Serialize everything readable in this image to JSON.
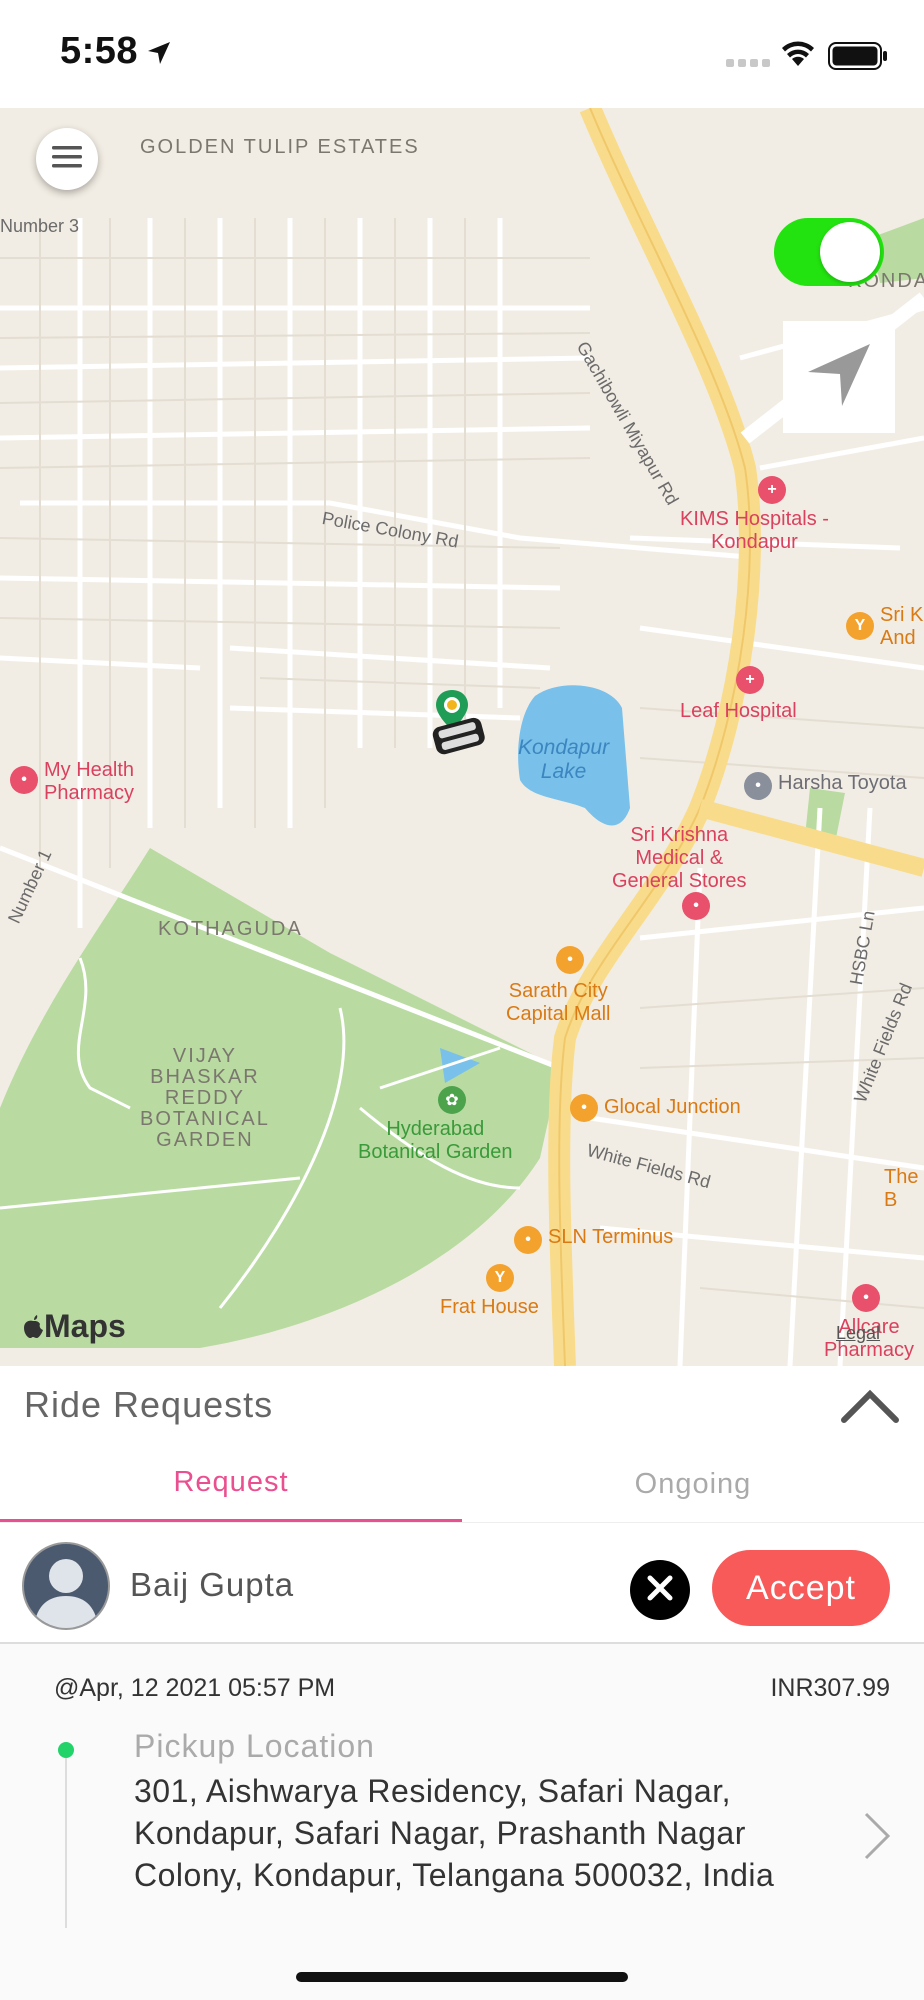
{
  "status_bar": {
    "time": "5:58",
    "icons": [
      "location-arrow-icon",
      "signal-icon",
      "wifi-icon",
      "battery-icon"
    ]
  },
  "map": {
    "areas": [
      "GOLDEN TULIP\nESTATES",
      "KOTHAGUDA",
      "VIJAY\nBHASKAR\nREDDY\nBOTANICAL\nGARDEN"
    ],
    "water": [
      "Kondapur\nLake"
    ],
    "roads": [
      "Gachibowli Miyapur Rd",
      "Police Colony Rd",
      "White Fields Rd",
      "HSBC Ln",
      "White Fields Rd",
      "Number 3",
      "Number 1"
    ],
    "pois": {
      "kims": "KIMS Hospitals -\nKondapur",
      "leaf": "Leaf Hospital",
      "myhealth": "My Health\nPharmacy",
      "harsha": "Harsha Toyota",
      "srikrishna": "Sri Krishna\nMedical &\nGeneral Stores",
      "sarath": "Sarath City\nCapital Mall",
      "hyd_botanical": "Hyderabad\nBotanical Garden",
      "glocal": "Glocal Junction",
      "sln": "SLN Terminus",
      "frat": "Frat House",
      "allcare": "Allcare\nPharmacy",
      "sri_k_partial": "Sri K\nAnd",
      "the_b_partial": "The\nB",
      "kondapur_partial": "KONDAPU"
    },
    "brand": "Maps",
    "legal": "Legal",
    "online_toggle": "on",
    "colors": {
      "toggle": "#22e30f",
      "park": "#b9dba1",
      "water": "#79c0ea",
      "major_road": "#f8dc8c"
    }
  },
  "sheet": {
    "title": "Ride Requests",
    "tabs": [
      {
        "label": "Request",
        "active": true
      },
      {
        "label": "Ongoing",
        "active": false
      }
    ],
    "request": {
      "rider_name": "Baij Gupta",
      "accept_label": "Accept",
      "datetime": "@Apr, 12 2021 05:57 PM",
      "fare": "INR307.99",
      "pickup_label": "Pickup Location",
      "pickup_address": "301, Aishwarya Residency, Safari Nagar, Kondapur, Safari Nagar, Prashanth Nagar Colony, Kondapur, Telangana 500032, India"
    },
    "colors": {
      "accent": "#ea4f8f",
      "accept": "#f85a5a",
      "pickup_dot": "#22d36a"
    }
  }
}
